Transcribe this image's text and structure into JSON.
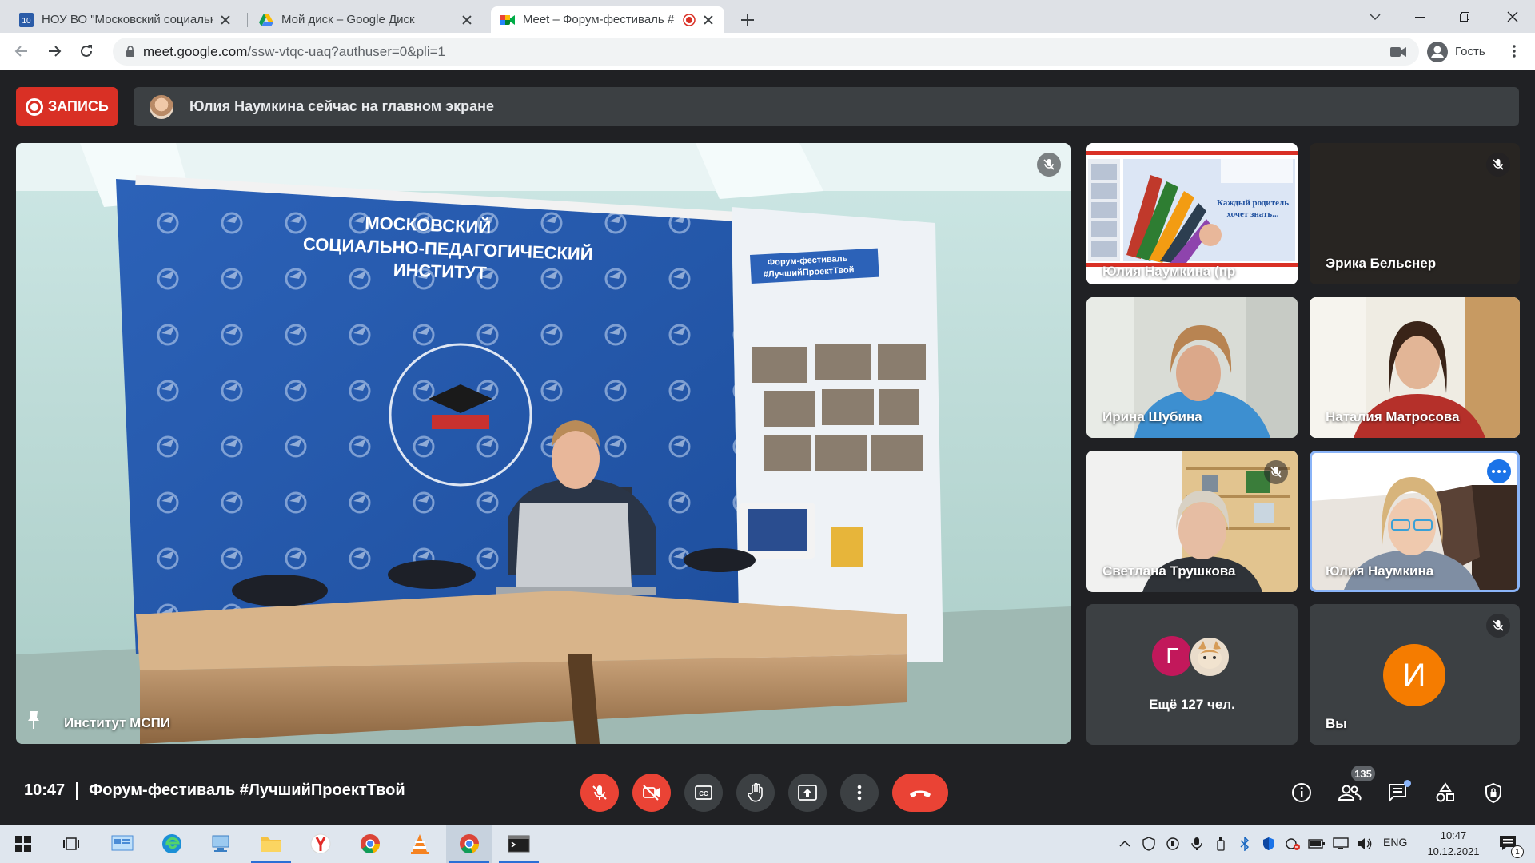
{
  "browser": {
    "tabs": [
      {
        "title": "НОУ ВО \"Московский социальн",
        "favicon": "site-favicon-10",
        "active": false
      },
      {
        "title": "Мой диск – Google Диск",
        "favicon": "google-drive-icon",
        "active": false
      },
      {
        "title": "Meet – Форум-фестиваль #",
        "favicon": "google-meet-icon",
        "active": true,
        "recording": true
      }
    ],
    "url_host": "meet.google.com",
    "url_path": "/ssw-vtqc-uaq?authuser=0&pli=1",
    "profile_label": "Гость"
  },
  "meet": {
    "record_label": "ЗАПИСЬ",
    "presenting_banner": "Юлия Наумкина сейчас на главном экране",
    "main_tile": {
      "name": "Институт МСПИ",
      "backdrop_title": [
        "МОСКОВСКИЙ",
        "СОЦИАЛЬНО-ПЕДАГОГИЧЕСКИЙ",
        "ИНСТИТУТ"
      ],
      "banner_text": [
        "Форум-фестиваль",
        "#ЛучшийПроектТвой"
      ]
    },
    "tiles": [
      {
        "name": "Юлия Наумкина (пр",
        "kind": "presentation",
        "slide_text": [
          "Каждый родитель",
          "хочет знать..."
        ],
        "muted": false
      },
      {
        "name": "Эрика Бельснер",
        "kind": "dark",
        "muted": true
      },
      {
        "name": "Ирина Шубина",
        "kind": "video",
        "muted": false
      },
      {
        "name": "Наталия Матросова",
        "kind": "video",
        "muted": false
      },
      {
        "name": "Светлана Трушкова",
        "kind": "video",
        "muted": true
      },
      {
        "name": "Юлия Наумкина",
        "kind": "video",
        "muted": false,
        "active_speaker": true
      },
      {
        "name": "Ещё 127 чел.",
        "kind": "others",
        "avatar_letter": "Г"
      },
      {
        "name": "Вы",
        "kind": "self",
        "avatar_letter": "И",
        "muted": true
      }
    ],
    "time": "10:47",
    "meeting_title": "Форум-фестиваль #ЛучшийПроектТвой",
    "participants_count": "135"
  },
  "taskbar": {
    "lang": "ENG",
    "clock_time": "10:47",
    "clock_date": "10.12.2021",
    "notifications": "1"
  },
  "colors": {
    "meet_bg": "#202124",
    "tile_bg": "#3c4043",
    "red": "#ea4335",
    "record_red": "#d93025",
    "active_border": "#8ab4f8",
    "avatar_orange": "#f57c00",
    "avatar_pink": "#c2185b"
  }
}
